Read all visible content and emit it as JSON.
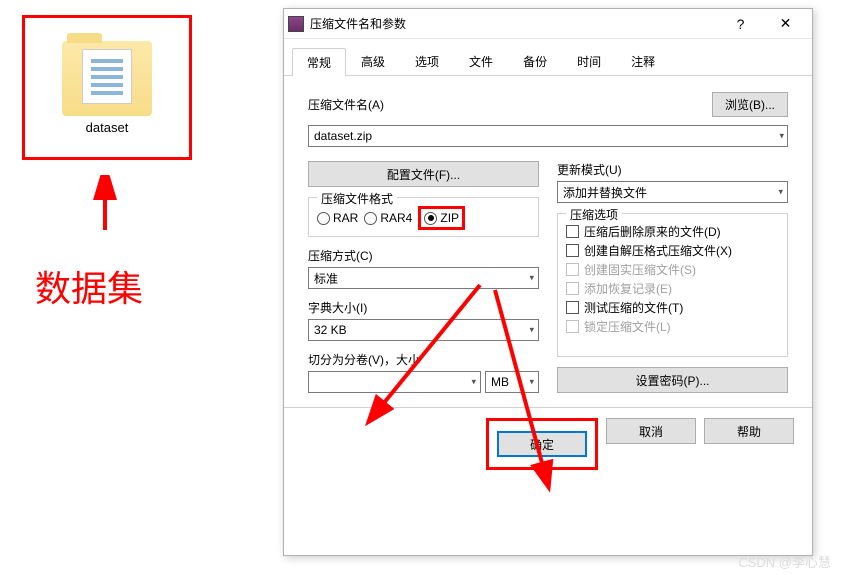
{
  "folder": {
    "label": "dataset"
  },
  "dataset_label": "数据集",
  "dialog": {
    "title": "压缩文件名和参数",
    "help_btn": "?",
    "close_btn": "✕",
    "tabs": [
      "常规",
      "高级",
      "选项",
      "文件",
      "备份",
      "时间",
      "注释"
    ],
    "active_tab": 0,
    "archive_name_label": "压缩文件名(A)",
    "browse_btn": "浏览(B)...",
    "archive_name_value": "dataset.zip",
    "profiles_btn": "配置文件(F)...",
    "update_mode_label": "更新模式(U)",
    "update_mode_value": "添加并替换文件",
    "format_label": "压缩文件格式",
    "formats": {
      "rar": "RAR",
      "rar4": "RAR4",
      "zip": "ZIP"
    },
    "format_selected": "zip",
    "method_label": "压缩方式(C)",
    "method_value": "标准",
    "dict_label": "字典大小(I)",
    "dict_value": "32 KB",
    "volume_label": "切分为分卷(V)，大小",
    "volume_unit": "MB",
    "options_label": "压缩选项",
    "options": [
      {
        "label": "压缩后删除原来的文件(D)",
        "checked": false,
        "enabled": true
      },
      {
        "label": "创建自解压格式压缩文件(X)",
        "checked": false,
        "enabled": true
      },
      {
        "label": "创建固实压缩文件(S)",
        "checked": false,
        "enabled": false
      },
      {
        "label": "添加恢复记录(E)",
        "checked": false,
        "enabled": false
      },
      {
        "label": "测试压缩的文件(T)",
        "checked": false,
        "enabled": true
      },
      {
        "label": "锁定压缩文件(L)",
        "checked": false,
        "enabled": false
      }
    ],
    "password_btn": "设置密码(P)...",
    "ok": "确定",
    "cancel": "取消",
    "help": "帮助"
  },
  "watermark": "CSDN @李心慧"
}
